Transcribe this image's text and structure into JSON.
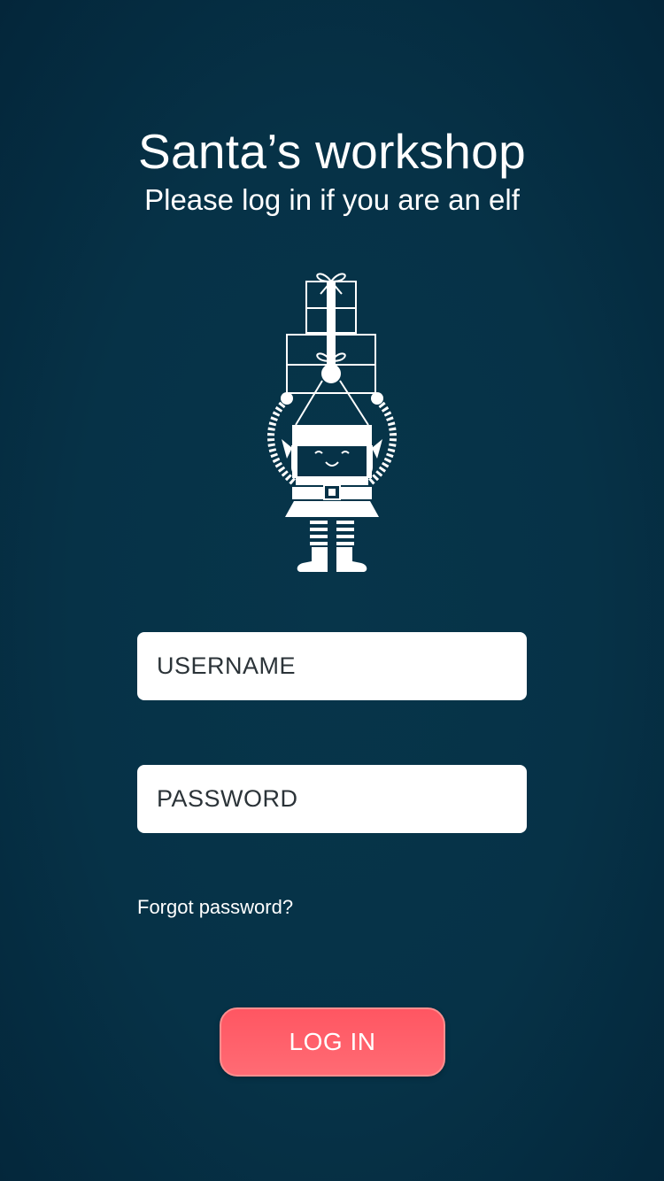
{
  "header": {
    "title": "Santa’s workshop",
    "subtitle": "Please log in if you are an elf"
  },
  "illustration": {
    "icon": "elf-carrying-presents-icon"
  },
  "form": {
    "username_placeholder": "USERNAME",
    "password_placeholder": "PASSWORD",
    "forgot_label": "Forgot password?",
    "login_label": "LOG IN"
  },
  "colors": {
    "background": "#063247",
    "accent": "#ff5c67",
    "field_bg": "#ffffff",
    "text": "#ffffff"
  }
}
